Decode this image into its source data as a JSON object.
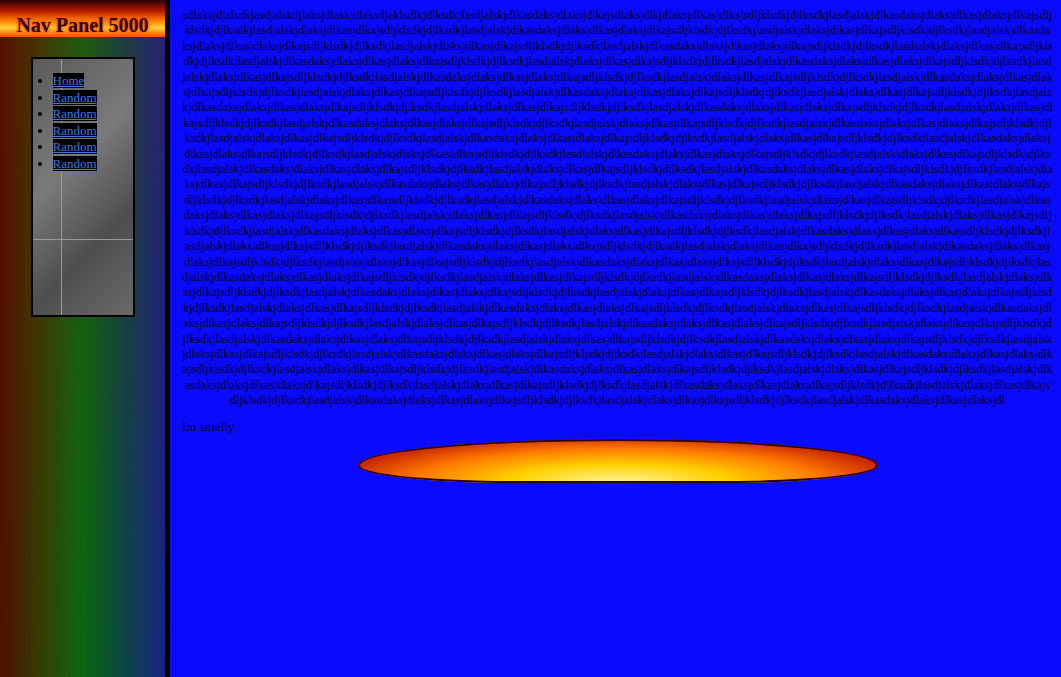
{
  "sidebar": {
    "title": "Nav Panel 5000",
    "items": [
      {
        "label": "Home"
      },
      {
        "label": "Random"
      },
      {
        "label": "Random"
      },
      {
        "label": "Random"
      },
      {
        "label": "Random"
      },
      {
        "label": "Random"
      }
    ]
  },
  "main": {
    "heading": "sdlaksjdjalsdkjasdjalskdjlaksjdlaskjdlaksdjaklsdlkjdlksdkjlasdjalskjdlkasdaksjdlaksjdlkajsdlaksjdlkjdlaksjdlkasjdlkajsdljklsdkjdjlksdkjlasdjalskjdlkasdaksjdlaksjdlkasjdlaksjdlkajsdljklsdkjdjlksdkjlasdjalskjdlaksjdlkasjdlkajsdljklsdkjdjlksdkjlasdjalskjdlkasdaksjdlaksjdlkasjdlaksjdlkajsdljklsdkjdjlksdkjlasdjalskjdlaksjdlkasjdlkajsdljklsdkjdjlksdkjlasdjalskjdlkasdaksjdlaksjdlkasjdlaksjdlkajsdljklsdkjdjlksdkjlasdjalskjdlaksjdlkasjdlkajsdljklsdkjdjlksdkjlasdjalskjdlkasdaksjdlaksjdlkasjdlaksjdlkajsdljklsdkjdjlksdkjlasdjalskjdlaksjdlkasjdlkajsdljklsdkjdjlksdkjlasdjalskjdlkasdaksjdlaksjdlkasjdlaksjdlkajsdljklsdkjdjlksdkjlasdjalskjdlaksjdlkasjdlkajsdljklsdkjdjlksdkjlasdjalskjdlkasdaksjdlaksjdlkasjdlaksjdlkajsdljklsdkjdjlksdkjlasdjalskjdlaksjdlkasjdlkajsdljklsdkjdjlksdkjlasdjalskjdlkasdaksjdlaksjdlkasjdlaksjdlkajsdljklsdkjdjlksdkjlasdjalskjdlaksjdlkasjdlkajsdljklsdkjdjlksdkjlasdjalskjdlkasdaksjdlaksjdlkasjdlaksjdlkajsdljklsdkjdjlksdkjlasdjalskjdlaksjdlkasjdlkajsdljklsdkjdjlksdkjlasdjalskjdlkasdaksjdlaksjdlkasjdlaksjdlkajsdljklsdkjdjlksdkjlasdjalskjdlaksjdlkasjdlkajsdljklsdkjdjlksdkjlasdjalskjdlkasdaksjdlaksjdlkasjdlaksjdlkajsdljklsdkjdjlksdkjlasdjalskjdlaksjdlkasjdlkajsdljklsdkjdjlksdkjlasdjalskjdlkasdaksjdlaksjdlkasjdlaksjdlkajsdljklsdkjdjlksdkjlasdjalskjdlaksjdlkasjdlkajsdljklsdkjdjlksdkjlasdjalskjdlkasdaksjdlaksjdlkasjdlaksjdlkajsdljklsdkjdjlksdkjlasdjalskjdlaksjdlkasjdlkajsdljklsdkjdjlksdkjlasdjalskjdlkasdaksjdlaksjdlkasjdlaksjdlkajsdljklsdkjdjlksdkjlasdjalskjdlaksjdlkasjdlkajsdljklsdkjdjlksdkjlasdjalskjdlkasdaksjdlaksjdlkasjdlaksjdlkajsdljklsdkjdjlksdkjlasdjalskjdlaksjdlkasjdlkajsdljklsdkjdjlksdkjlasdjalskjdlkasdaksjdlaksjdlkasjdlaksjdlkajsdljklsdkjdjlksdkjlasdjalskjdlaksjdlkasjdlkajsdljklsdkjdjlksdkjlasdjalskjdlkasdaksjdlaksjdlkasjdlaksjdlkajsdljklsdkjdjlksdkjlasdjalskjdlaksjdlkasjdlkajsdljklsdkjdjlksdkjlasdjalskjdlkasdaksjdlaksjdlkasjdlaksjdlkajsdljklsdkjdjlksdkjlasdjalskjdlaksjdlkasjdlkajsdljklsdkjdjlksdkjlasdjalskjdlkasdaksjdlaksjdlkasjdlaksjdlkajsdljklsdkjdjlksdkjlasdjalskjdlaksjdlkasjdlkajsdljklsdkjdjlksdkjlasdjalskjdlkasdaksjdlaksjdlkasjdlaksjdlkajsdljklsdkjdjlksdkjlasdjalskjdlaksjdlkasjdlkajsdljklsdkjdjlksdkjlasdjalskjdlkasdaksjdlaksjdlkasjdlaksjdlkajsdljklsdkjdjlksdkjlasdjalskjdlaksjdlkasjdlkajsdljklsdkjdjlksdkjlasdjalskjdlkasdaksjdlaksjdlkasjdlaksjdlkajsdljklsdkjdjlksdkjlasdjalskjdlaksjdlkasjdlkajsdljklsdkjdjlksdkjlasdjalskjdlkasdaksjdlaksjdlkasjdlaksjdlkajsdljklsdkjdjlksdkjlasdjalskjdlaksjdlkasjdlkajsdljklsdkjdjlksdkjlasdjalskjdlkasdaksjdlaksjdlkasjdlaksjdlkajsdljklsdkjdjlksdkjlasdjalskjdlaksjdlkasjdlkajsdljklsdkjdjlksdkjlasdjalskjdlkasdaksjdlaksjdlkasjdlaksjdlkajsdljklsdkjdjlksdkjlasdjalskjdlaksjdlkasjdlkajsdljklsdkjdjlksdkjlasdjalskjdlkasdaksjdlaksjdlkasjdlaksjdlkajsdljklsdkjdjlksdkjlasdjalskjdlaksjdlkasjdlkajsdljklsdkjdjlksdkjlasdjalskjdlkasdaksjdlaksjdlkasjdlaksjdlkajsdljklsdkjdjlksdkjlasdjalskjdlaksjdlkasjdlkajsdljklsdkjdjlksdkjlasdjalskjdlkasdaksjdlaksjdlkasjdlaksjdlkajsdljklsdkjdjlksdkjlasdjalskjdlaksjdlkasjdlkajsdljklsdkjdjlksdkjlasdjalskjdlkasdaksjdlaksjdlkasjdlaksjdlkajsdljklsdkjdjlksdkjlasdjalskjdlaksjdlkasjdlkajsdljklsdkjdjlksdkjlasdjalskjdlkasdaksjdlaksjdlkasjdlaksjdlkajsdljklsdkjdjlksdkjlasdjalskjdlaksjdlkasjdlkajsdljklsdkjdjlksdkjlasdjalskjdlkasdaksjdlaksjdlkasjdlaksjdlkajsdljklsdkjdjlksdkjlasdjalskjdlaksjdlkasjdlkajsdljklsdkjdjlksdkjlasdjalskjdlkasdaksjdlaksjdlkasjdlaksjdlkajsdljklsdkjdjlksdkjlasdjalskjdlaksjdlkasjdlkajsdljklsdkjdjlksdkjlasdjalskjdlkasdaksjdlaksjdlkasjdlaksjdlkajsdljklsdkjdjlksdkjlasdjalskjdlaksjdlkasjdlkajsdljklsdkjdjlksdkjlasdjalskjdlkasdaksjdlaksjdlkasjdlaksjdlkajsdljklsdkjdjlksdkjlasdjalskjdlaksjdlkasjdlkajsdljklsdkjdjlksdkjlasdjalskjdlkasdaksjdlaksjdlkasjdlaksjdlkajsdljklsdkjdjlksdkjlasdjalskjdlaksjdlkasjdlkajsdljklsdkjdjlksdkjlasdjalskjdlkasdaksjdlaksjdlkasjdlaksjdlkajsdljklsdkjdjlksdkjlasdjalskjdlaksjdlkasjdlkajsdljklsdkjdjlksdkjlasdjalskjdlkasdaksjdlaksjdlkasjdlaksjdlkajsdljklsdkjdjlksdkjlasdjalskjdlaksjdlkasjdlkajsdljklsdkjdjlksdkjlasdjalskjdlkasdaksjdlaksjdlkasjdlaksjdlkajsdljklsdkjdjlksdkjlasdjalskjdlaksjdlkasjdlkajsdljklsdkjdjlksdkjlasdjalskjdlkasdaksjdlaksjdlkasjdlaksjdlkajsdljklsdkjdjlksdkjlasdjalskjdlaksjdlkasjdlkajsdljklsdkjdjlksdkjlasdjalskjdlkasdaksjdlaksjdlkasjdlaksjdlkajsdljklsdkjdjlksdkjlasdjalskjdlaksjdlkasjdlkajsdljklsdkjdjlksdkjlasdjalskjdlkasdaksjdlaksjdlkasjdlaksjdlkajsdljklsdkjdjlksdkjlasdjalskjdlaksjdlkasjdlkajsdljklsdkjdjlksdkjlasdjalskjdlkasdaksjdlaksjdlkasjdlaksjdlkajsdljklsdkjdjlksdkjlasdjalskjdlaksjdlkasjdlkajsdljklsdkjdjlksdkjlasdjalskjdlkasdaksjdlaksjdlkasjdlaksjdlkajsdljklsdkjdjlksdkjlasdjalskjdlaksjdlkasjdlkajsdljklsdkjdjlksdkjlasdjalskjdlkasdaksjdlaksjdlkasjdlaksjdlkajsdljklsdkjdjlksdkjlasdjalskjdlaksjdlkasjdlkajsdljklsdkjdjlksdkjlasdjalskjdlkasdaksjdlaksjdlkasjdlaksjdl",
    "caption": "Im smelly"
  }
}
